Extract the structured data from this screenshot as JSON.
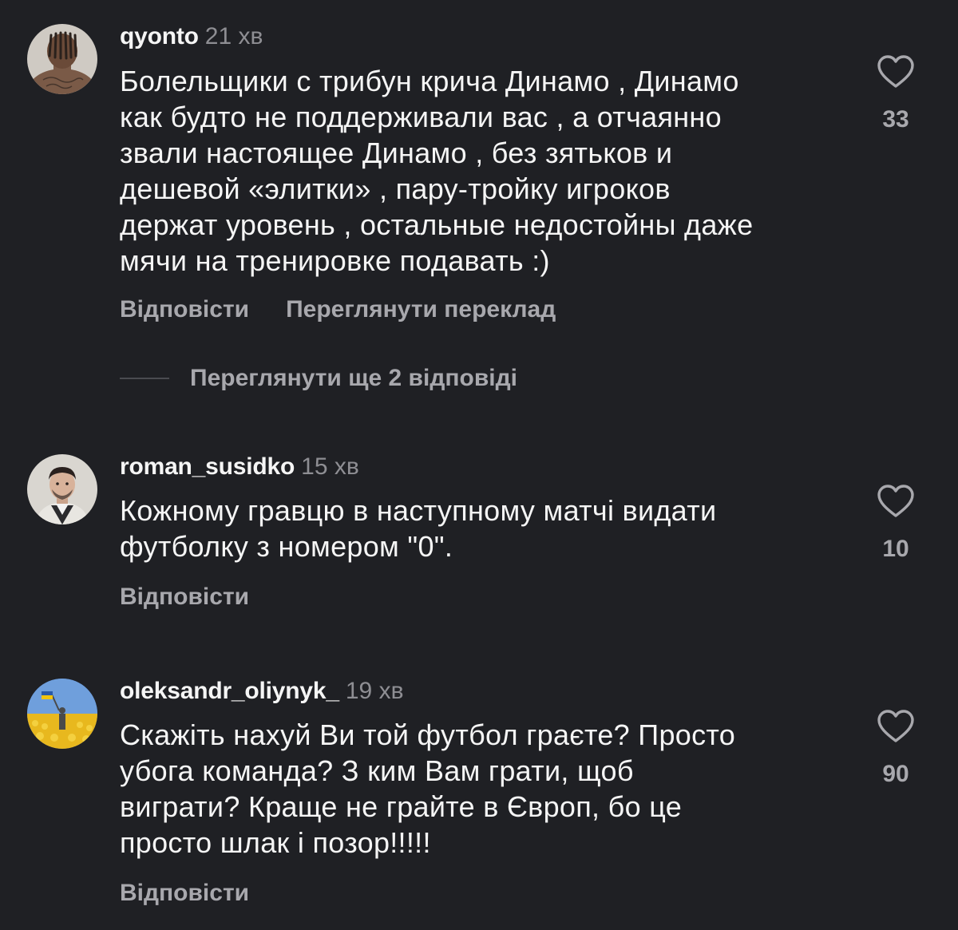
{
  "comments": [
    {
      "username": "qyonto",
      "time": "21 хв",
      "text": "Болельщики с трибун крича Динамо , Динамо\nкак будто не поддерживали вас , а отчаянно\nзвали настоящее Динамо , без зятьков и\nдешевой «элитки» , пару-тройку игроков\nдержат уровень , остальные недостойны даже\nмячи на тренировке подавать :)",
      "reply_label": "Відповісти",
      "translate_label": "Переглянути переклад",
      "likes": "33",
      "icons": {
        "avatar": "avatar-tattooed-man-back",
        "like": "heart-outline-icon"
      }
    },
    {
      "username": "roman_susidko",
      "time": "15 хв",
      "text": "Кожному гравцю в наступному матчі видати\nфутболку з номером \"0\".",
      "reply_label": "Відповісти",
      "likes": "10",
      "icons": {
        "avatar": "avatar-man-portrait",
        "like": "heart-outline-icon"
      }
    },
    {
      "username": "oleksandr_oliynyk_",
      "time": "19 хв",
      "text": "Скажіть нахуй Ви той футбол граєте? Просто\nубога команда? З ким Вам грати, щоб\nвиграти? Краще не грайте в Європ, бо це\nпросто шлак і позор!!!!!",
      "reply_label": "Відповісти",
      "likes": "90",
      "icons": {
        "avatar": "avatar-sunflower-field-flag",
        "like": "heart-outline-icon"
      }
    }
  ],
  "view_replies_label": "Переглянути ще 2 відповіді",
  "colors": {
    "background": "#1f2024",
    "primary_text": "#f5f5f5",
    "secondary_text": "#a8a8ad",
    "timestamp": "#8e8e93"
  }
}
